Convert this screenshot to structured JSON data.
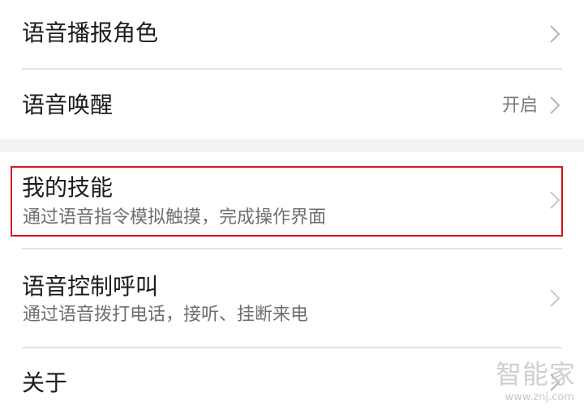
{
  "items": [
    {
      "title": "语音播报角色"
    },
    {
      "title": "语音唤醒",
      "value": "开启"
    },
    {
      "title": "我的技能",
      "subtitle": "通过语音指令模拟触摸，完成操作界面"
    },
    {
      "title": "语音控制呼叫",
      "subtitle": "通过语音拨打电话，接听、挂断来电"
    },
    {
      "title": "关于"
    }
  ],
  "icons": {
    "chevron": "chevron-right-icon"
  },
  "colors": {
    "highlight": "#d9141b",
    "title": "#1b1b1b",
    "subtitle": "#6f6f6f"
  },
  "watermark": {
    "text": "智能家",
    "url": "www.znj.com"
  }
}
